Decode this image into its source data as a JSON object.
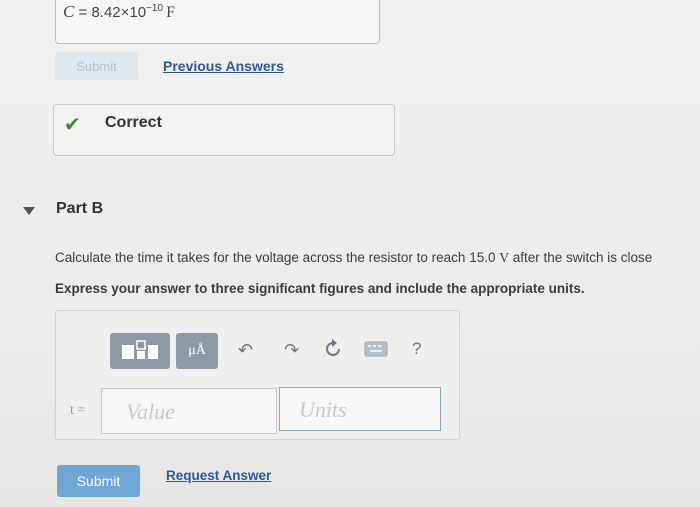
{
  "previous": {
    "c_symbol": "C",
    "equals": " = ",
    "mantissa": "8.42×10",
    "exponent": "−10",
    "unit": "F",
    "submit_label": "Submit",
    "previous_answers_label": "Previous Answers"
  },
  "feedback": {
    "label": "Correct"
  },
  "part_b": {
    "title": "Part B",
    "question_before": "Calculate the time it takes for the voltage across the resistor to reach 15.0 ",
    "question_unit": "V",
    "question_after": " after the switch is close",
    "instruction": "Express your answer to three significant figures and include the appropriate units."
  },
  "toolbar": {
    "units_label": "μÅ",
    "help_label": "?"
  },
  "answer": {
    "variable_label": "t =",
    "value_placeholder": "Value",
    "units_placeholder": "Units"
  },
  "actions": {
    "submit_label": "Submit",
    "request_answer_label": "Request Answer"
  },
  "colors": {
    "link": "#2a5a9a",
    "check": "#3a8a3a",
    "submit_bg": "#6fa6d8",
    "toolbar_btn": "#8d99a6"
  }
}
